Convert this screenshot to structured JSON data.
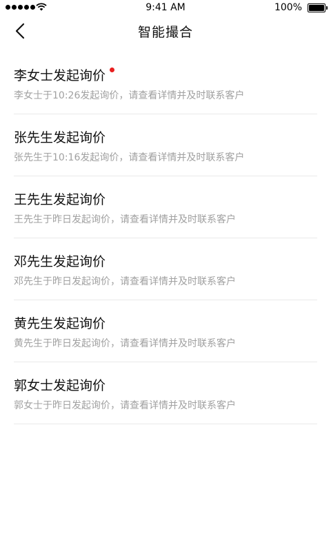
{
  "status_bar": {
    "time": "9:41 AM",
    "battery": "100%"
  },
  "nav": {
    "title": "智能撮合",
    "back_icon": "chevron-left-icon"
  },
  "colors": {
    "unread_dot": "#e81f1f",
    "subtitle": "#a0a0a0",
    "divider": "#e9e9e9"
  },
  "list": [
    {
      "title": "李女士发起询价",
      "subtitle": "李女士于10:26发起询价，请查看详情并及时联系客户",
      "unread": true
    },
    {
      "title": "张先生发起询价",
      "subtitle": "张先生于10:16发起询价，请查看详情并及时联系客户",
      "unread": false
    },
    {
      "title": "王先生发起询价",
      "subtitle": "王先生于昨日发起询价，请查看详情并及时联系客户",
      "unread": false
    },
    {
      "title": "邓先生发起询价",
      "subtitle": "邓先生于昨日发起询价，请查看详情并及时联系客户",
      "unread": false
    },
    {
      "title": "黄先生发起询价",
      "subtitle": "黄先生于昨日发起询价，请查看详情并及时联系客户",
      "unread": false
    },
    {
      "title": "郭女士发起询价",
      "subtitle": "郭女士于昨日发起询价，请查看详情并及时联系客户",
      "unread": false
    }
  ]
}
